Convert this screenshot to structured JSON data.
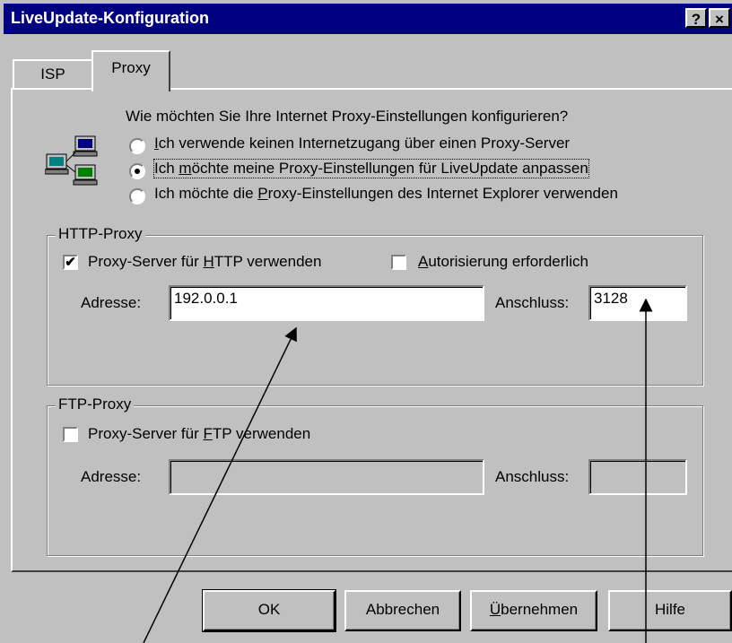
{
  "window": {
    "title": "LiveUpdate-Konfiguration",
    "help_button": "?",
    "close_button": "×"
  },
  "tabs": [
    {
      "label": "ISP",
      "active": false
    },
    {
      "label": "Proxy",
      "active": true
    }
  ],
  "question": "Wie möchten Sie Ihre Internet Proxy-Einstellungen konfigurieren?",
  "radio_options": [
    {
      "pre": "",
      "accel": "I",
      "post": "ch verwende keinen Internetzugang über einen Proxy-Server",
      "selected": false
    },
    {
      "pre": "Ich ",
      "accel": "m",
      "post": "öchte meine Proxy-Einstellungen für LiveUpdate anpassen",
      "selected": true
    },
    {
      "pre": "Ich möchte die ",
      "accel": "P",
      "post": "roxy-Einstellungen des Internet Explorer verwenden",
      "selected": false
    }
  ],
  "http_proxy": {
    "legend": "HTTP-Proxy",
    "use_checkbox": {
      "pre": "Proxy-Server für ",
      "accel": "H",
      "post": "TTP verwenden",
      "checked": true
    },
    "auth_checkbox": {
      "pre": "",
      "accel": "A",
      "post": "utorisierung erforderlich",
      "checked": false
    },
    "address_label": "Adresse:",
    "address_value": "192.0.0.1",
    "port_label": "Anschluss:",
    "port_value": "3128"
  },
  "ftp_proxy": {
    "legend": "FTP-Proxy",
    "use_checkbox": {
      "pre": "Proxy-Server für ",
      "accel": "F",
      "post": "TP verwenden",
      "checked": false
    },
    "address_label": "Adresse:",
    "address_value": "",
    "port_label": "Anschluss:",
    "port_value": ""
  },
  "buttons": {
    "ok": "OK",
    "cancel": "Abbrechen",
    "apply_accel": "Ü",
    "apply_post": "bernehmen",
    "help": "Hilfe"
  },
  "icons": {
    "network": "network-computers-icon",
    "check_mark": "✔"
  }
}
